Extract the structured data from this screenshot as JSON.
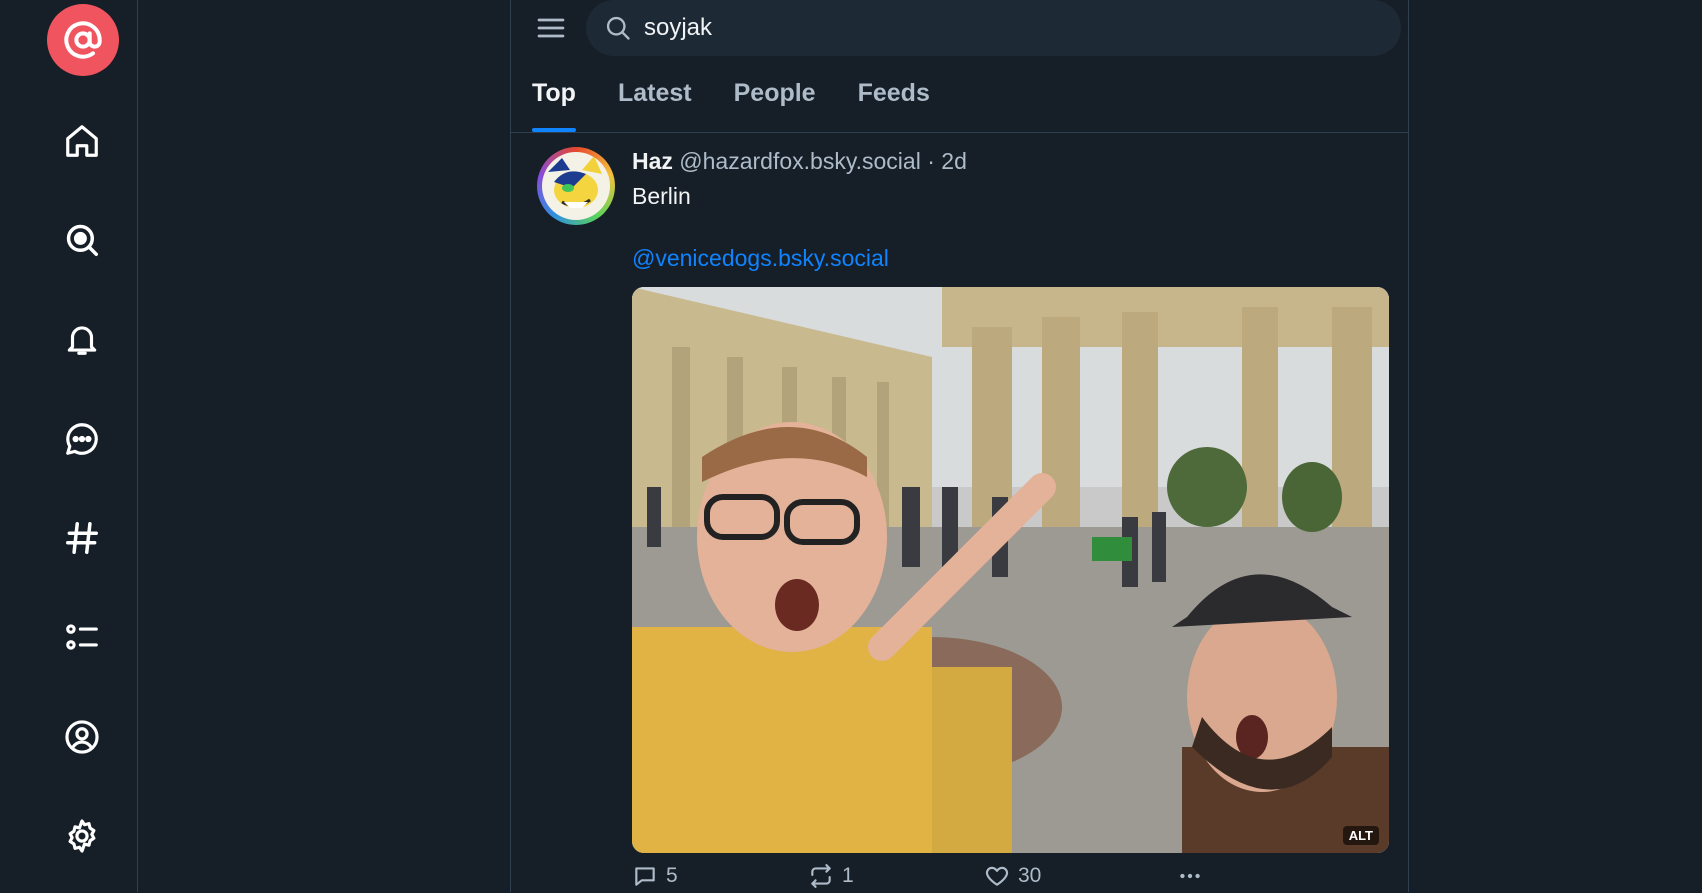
{
  "app": {
    "brand_icon": "at-sign-logo-icon",
    "accent": "#1083fe",
    "brand_color": "#f0545e"
  },
  "nav": [
    {
      "icon": "home-icon"
    },
    {
      "icon": "search-icon"
    },
    {
      "icon": "bell-icon"
    },
    {
      "icon": "chat-icon"
    },
    {
      "icon": "hashtag-icon"
    },
    {
      "icon": "list-icon"
    },
    {
      "icon": "profile-icon"
    },
    {
      "icon": "gear-icon"
    }
  ],
  "search": {
    "value": "soyjak"
  },
  "tabs": [
    {
      "label": "Top",
      "active": true
    },
    {
      "label": "Latest"
    },
    {
      "label": "People"
    },
    {
      "label": "Feeds"
    }
  ],
  "post": {
    "author": "Haz",
    "handle": "@hazardfox.bsky.social",
    "separator": "·",
    "time": "2d",
    "text": "Berlin",
    "mention": "@venicedogs.bsky.social",
    "alt_badge": "ALT",
    "replies": "5",
    "reposts": "1",
    "likes": "30"
  }
}
